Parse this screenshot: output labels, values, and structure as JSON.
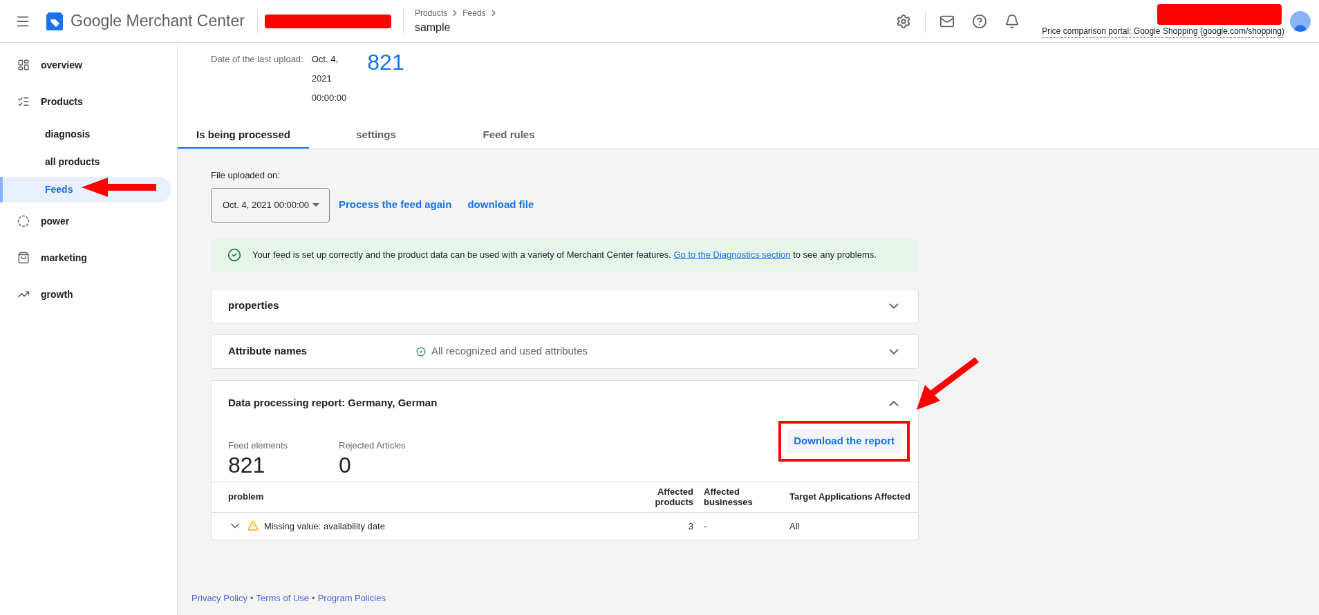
{
  "header": {
    "app_title_google": "Google",
    "app_title_rest": "Merchant Center",
    "breadcrumb": [
      "Products",
      "Feeds"
    ],
    "page_title": "sample",
    "portal_text": "Price comparison portal: Google Shopping (google.com/shopping)"
  },
  "sidebar": {
    "items": [
      {
        "label": "overview",
        "selected": false
      },
      {
        "label": "Products",
        "selected": false,
        "children": [
          {
            "label": "diagnosis",
            "selected": false
          },
          {
            "label": "all products",
            "selected": false
          },
          {
            "label": "Feeds",
            "selected": true
          }
        ]
      },
      {
        "label": "power",
        "selected": false
      },
      {
        "label": "marketing",
        "selected": false
      },
      {
        "label": "growth",
        "selected": false
      }
    ]
  },
  "summary": {
    "label": "Date of the last upload:",
    "date_lines": [
      "Oct. 4,",
      "2021",
      "00:00:00"
    ],
    "count": "821"
  },
  "tabs": [
    {
      "label": "Is being processed",
      "selected": true
    },
    {
      "label": "settings",
      "selected": false
    },
    {
      "label": "Feed rules",
      "selected": false
    }
  ],
  "file_upload": {
    "label": "File uploaded on:",
    "dropdown_value": "Oct. 4, 2021 00:00:00",
    "links": [
      "Process the feed again",
      "download file"
    ]
  },
  "banner": {
    "text": "Your feed is set up correctly and the product data can be used with a variety of Merchant Center features.",
    "link": "Go to the Diagnostics section",
    "text_after": "to see any problems."
  },
  "accordions": [
    {
      "title": "properties",
      "expanded": false
    },
    {
      "title": "Attribute names",
      "status": "All recognized and used attributes",
      "expanded": false
    },
    {
      "title": "Data processing report: Germany, German",
      "expanded": true,
      "report": {
        "download_button": "Download the report",
        "stats": [
          {
            "label": "Feed elements",
            "value": "821"
          },
          {
            "label": "Rejected Articles",
            "value": "0"
          }
        ],
        "columns": [
          "problem",
          "Affected products",
          "Affected businesses",
          "Target Applications Affected"
        ],
        "rows": [
          {
            "expanded": false,
            "cells": [
              "Missing value: availability date",
              "3",
              "-",
              "All"
            ]
          }
        ]
      }
    }
  ],
  "footer": [
    {
      "kind": "link",
      "text": "Privacy Policy"
    },
    {
      "kind": "separator",
      "text": "•"
    },
    {
      "kind": "link",
      "text": "Terms of Use"
    },
    {
      "kind": "separator",
      "text": "•"
    },
    {
      "kind": "link",
      "text": "Program Policies"
    }
  ]
}
